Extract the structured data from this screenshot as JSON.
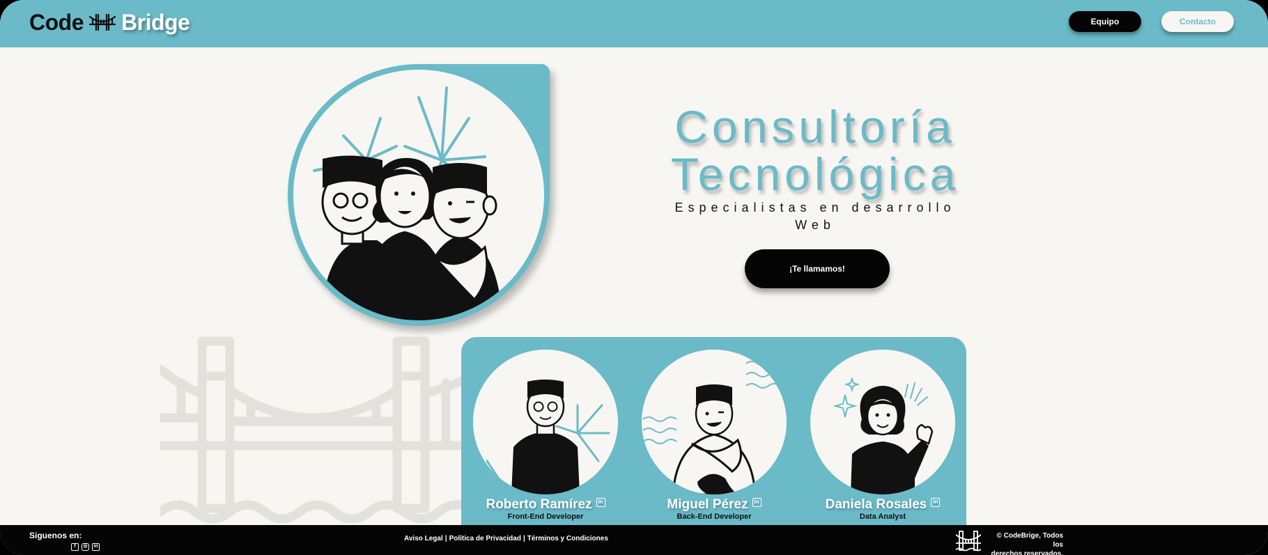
{
  "header": {
    "logo_word1": "Code",
    "logo_word2": "Bridge",
    "nav": {
      "equipo_label": "Equipo",
      "contacto_label": "Contacto"
    }
  },
  "hero": {
    "title_line1": "Consultoría",
    "title_line2": "Tecnológica",
    "subtitle_line1": "Especialistas en desarrollo",
    "subtitle_line2": "Web",
    "cta_label": "¡Te llamamos!"
  },
  "team": {
    "members": [
      {
        "name": "Roberto Ramírez",
        "role": "Front-End Developer",
        "social_icon": "linkedin-icon"
      },
      {
        "name": "Miguel Pérez",
        "role": "Back-End Developer",
        "social_icon": "linkedin-icon"
      },
      {
        "name": "Daniela Rosales",
        "role": "Data Analyst",
        "social_icon": "linkedin-icon"
      }
    ]
  },
  "footer": {
    "follow_label": "Siguenos en:",
    "social_icons": [
      "facebook-icon",
      "instagram-icon",
      "linkedin-icon"
    ],
    "links": [
      "Aviso Legal",
      "Política de Privacidad",
      "Términos y Condiciones"
    ],
    "link_separator": "|",
    "copyright_line1": "© CodeBrige, Todos los",
    "copyright_line2": "derechos reservados."
  },
  "colors": {
    "accent": "#6bbac8",
    "background": "#f7f6f2",
    "dark": "#050505",
    "bridge_watermark": "#e3e1dc"
  }
}
